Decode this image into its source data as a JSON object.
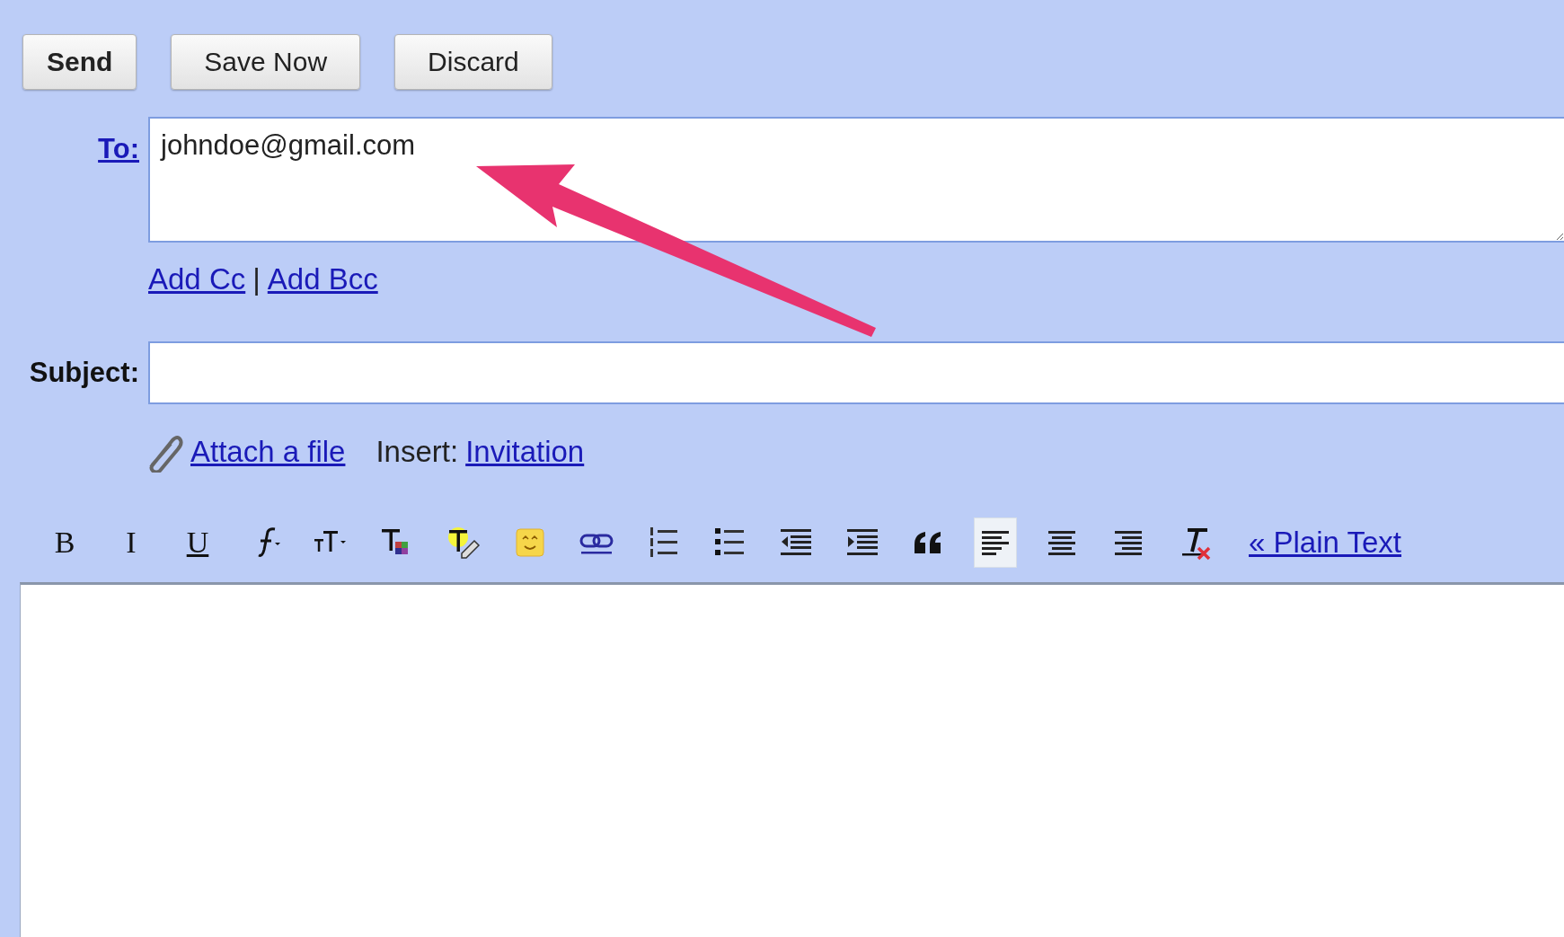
{
  "action_buttons": [
    {
      "label": "Send",
      "primary": true
    },
    {
      "label": "Save Now",
      "primary": false
    },
    {
      "label": "Discard",
      "primary": false
    }
  ],
  "to": {
    "label": "To:",
    "value": "johndoe@gmail.com"
  },
  "recipient_links": [
    {
      "label": "Add Cc"
    },
    {
      "label": "Add Bcc"
    }
  ],
  "recipient_separator": "|",
  "subject": {
    "label": "Subject:"
  },
  "attach_link": "Attach a file",
  "insert": {
    "label": "Insert:",
    "link": "Invitation"
  },
  "formatting_toolbar": [
    {
      "label": "B",
      "selected": false
    },
    {
      "label": "I",
      "selected": false
    },
    {
      "label": "U",
      "selected": false
    },
    {
      "selected": false
    },
    {
      "selected": false
    },
    {
      "selected": false
    },
    {
      "selected": false
    },
    {
      "selected": false
    },
    {
      "selected": false
    },
    {
      "selected": false
    },
    {
      "selected": false
    },
    {
      "selected": false
    },
    {
      "selected": false
    },
    {
      "selected": false
    },
    {
      "selected": true
    },
    {
      "selected": false
    },
    {
      "selected": false
    },
    {
      "selected": false
    }
  ],
  "plain_text_link": "« Plain Text"
}
